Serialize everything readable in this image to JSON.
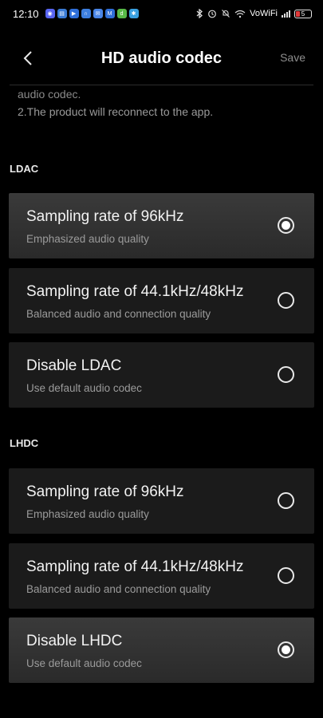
{
  "status_bar": {
    "time": "12:10",
    "network_label": "VoWiFi",
    "battery_level": "5",
    "notification_icons": [
      "discord-icon",
      "calendar-icon",
      "youtube-icon",
      "headphones-icon",
      "messages-icon",
      "mail-icon",
      "duo-icon",
      "app-icon"
    ],
    "status_icons": [
      "bluetooth-icon",
      "alarm-icon",
      "mute-icon",
      "wifi-icon",
      "signal-icon",
      "battery-icon"
    ]
  },
  "header": {
    "title": "HD audio codec",
    "save_label": "Save",
    "back_icon": "chevron-left-icon"
  },
  "notes": {
    "partial_line": "audio codec.",
    "line2": "2.The product will reconnect to the app."
  },
  "sections": [
    {
      "title": "LDAC",
      "options": [
        {
          "title": "Sampling rate of 96kHz",
          "subtitle": "Emphasized audio quality",
          "selected": true
        },
        {
          "title": "Sampling rate of 44.1kHz/48kHz",
          "subtitle": "Balanced audio and connection quality",
          "selected": false
        },
        {
          "title": "Disable LDAC",
          "subtitle": "Use default audio codec",
          "selected": false
        }
      ]
    },
    {
      "title": "LHDC",
      "options": [
        {
          "title": "Sampling rate of 96kHz",
          "subtitle": "Emphasized audio quality",
          "selected": false
        },
        {
          "title": "Sampling rate of 44.1kHz/48kHz",
          "subtitle": "Balanced audio and connection quality",
          "selected": false
        },
        {
          "title": "Disable LHDC",
          "subtitle": "Use default audio codec",
          "selected": true
        }
      ]
    }
  ],
  "colors": {
    "background": "#000000",
    "card": "#1b1b1b",
    "card_selected": "#333333",
    "secondary_text": "#9b9b9b",
    "save_text": "#8e8e8e"
  }
}
